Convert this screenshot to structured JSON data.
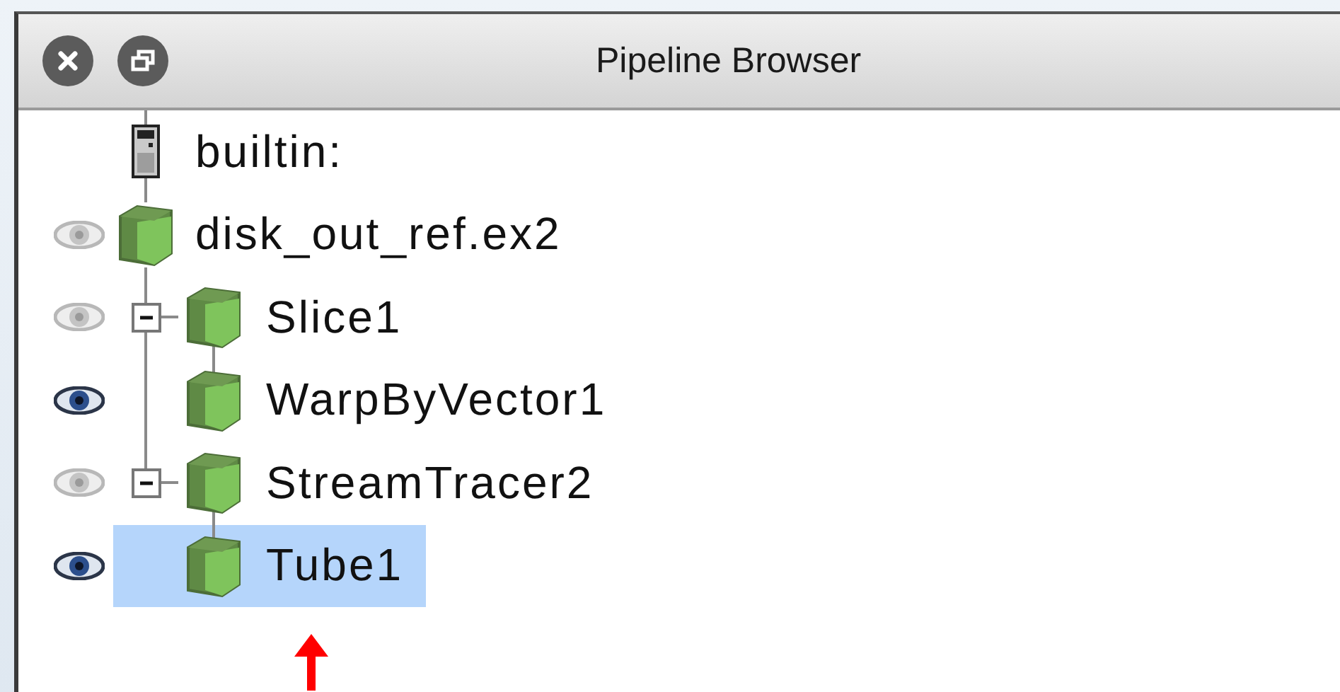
{
  "window": {
    "title": "Pipeline Browser"
  },
  "pipeline": [
    {
      "label": "builtin:",
      "kind": "server",
      "selected": false,
      "children": [
        {
          "label": "disk_out_ref.ex2",
          "kind": "source",
          "visible": false,
          "selected": false,
          "children": [
            {
              "label": "Slice1",
              "kind": "source",
              "visible": false,
              "expanded": true,
              "selected": false,
              "children": [
                {
                  "label": "WarpByVector1",
                  "kind": "source",
                  "visible": true,
                  "selected": false
                }
              ]
            },
            {
              "label": "StreamTracer2",
              "kind": "source",
              "visible": false,
              "expanded": true,
              "selected": false,
              "children": [
                {
                  "label": "Tube1",
                  "kind": "source",
                  "visible": true,
                  "selected": true
                }
              ]
            }
          ]
        }
      ]
    }
  ],
  "annotation": {
    "kind": "arrow"
  }
}
